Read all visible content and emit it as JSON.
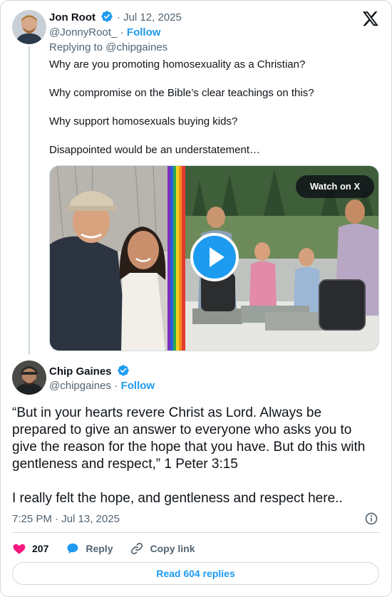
{
  "tweet1": {
    "author_name": "Jon Root",
    "date": "Jul 12, 2025",
    "handle": "@JonnyRoot_",
    "follow_label": "Follow",
    "replying_to": "Replying to @chipgaines",
    "paragraphs": [
      "Why are you promoting homosexuality as a Christian?",
      "Why compromise on the Bible’s clear teachings on this?",
      "Why support homosexuals buying kids?",
      "Disappointed would be an understatement…"
    ],
    "media": {
      "watch_label": "Watch on X"
    }
  },
  "tweet2": {
    "author_name": "Chip Gaines",
    "handle": "@chipgaines",
    "follow_label": "Follow",
    "paragraphs": [
      "“But in your hearts revere Christ as Lord. Always be prepared to give an answer to everyone who asks you to give the reason for the hope that you have. But do this with gentleness and respect,” 1 Peter 3:15",
      "I really felt the hope, and gentleness and respect here.."
    ],
    "timestamp": "7:25 PM · Jul 13, 2025"
  },
  "actions": {
    "likes": "207",
    "reply_label": "Reply",
    "copy_link_label": "Copy link"
  },
  "read_replies_label": "Read 604 replies",
  "colors": {
    "accent": "#1d9bf0",
    "like": "#f91880",
    "muted": "#536471"
  }
}
